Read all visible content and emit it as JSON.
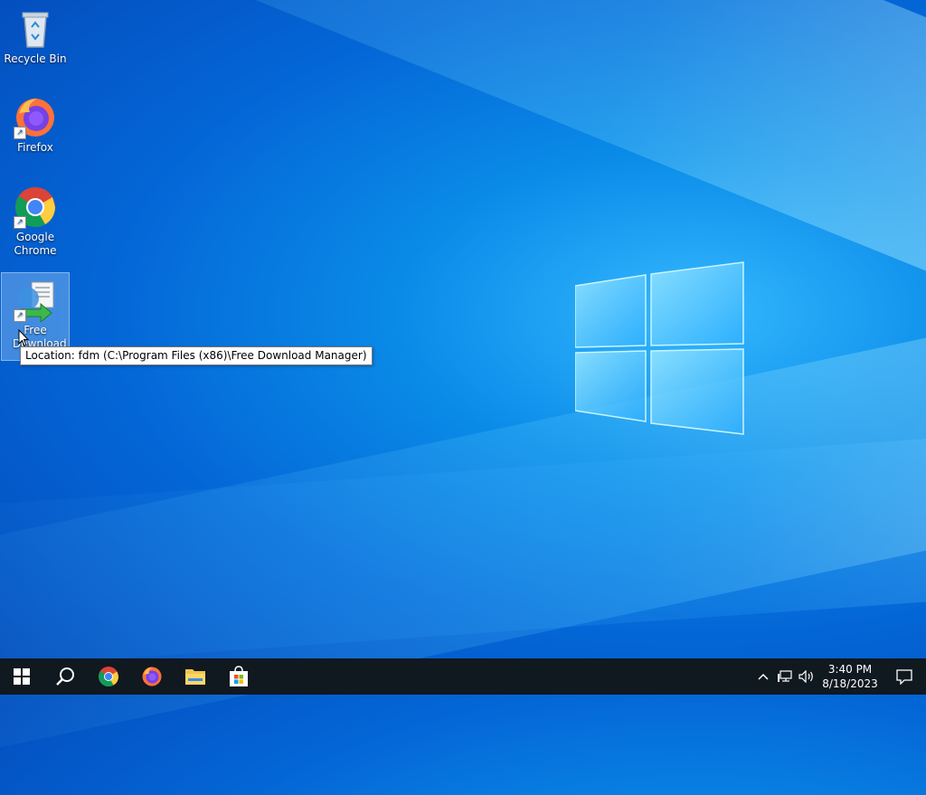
{
  "desktop": {
    "icons": [
      {
        "label": "Recycle Bin",
        "icon": "recycle-bin-icon"
      },
      {
        "label": "Firefox",
        "icon": "firefox-icon"
      },
      {
        "label": "Google Chrome",
        "icon": "chrome-icon"
      },
      {
        "label": "Free Download M",
        "icon": "free-download-manager-icon"
      }
    ],
    "tooltip": "Location: fdm (C:\\Program Files (x86)\\Free Download Manager)"
  },
  "taskbar": {
    "items": [
      {
        "name": "start",
        "icon": "windows-start-icon"
      },
      {
        "name": "search",
        "icon": "search-icon"
      },
      {
        "name": "chrome",
        "icon": "chrome-icon"
      },
      {
        "name": "firefox",
        "icon": "firefox-icon"
      },
      {
        "name": "file-explorer",
        "icon": "folder-icon"
      },
      {
        "name": "microsoft-store",
        "icon": "store-icon"
      }
    ],
    "tray": {
      "chevron": "^",
      "time": "3:40 PM",
      "date": "8/18/2023"
    }
  },
  "colors": {
    "desktop_blue": "#0a8be8",
    "taskbar_bg": "#101820",
    "accent": "#0078d7"
  }
}
